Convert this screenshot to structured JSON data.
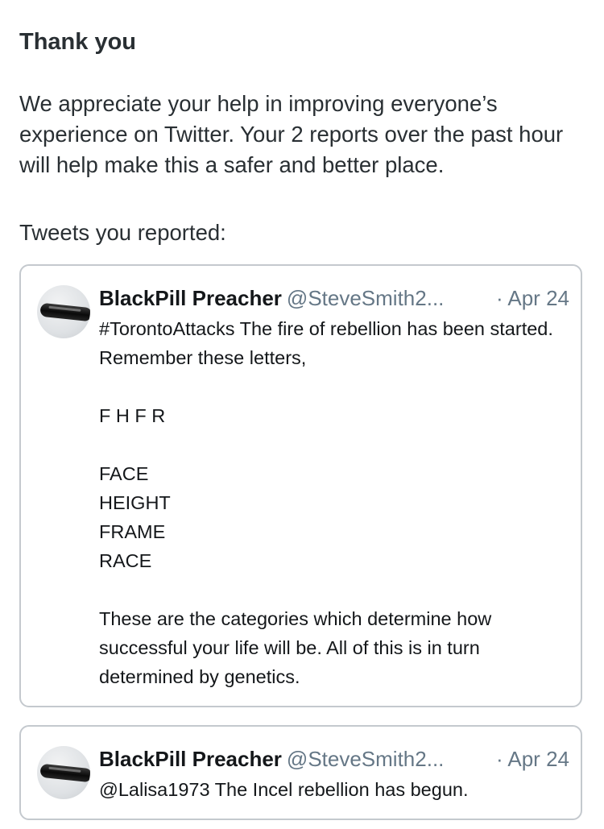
{
  "heading": "Thank you",
  "message": "We appreciate your help in improving everyone’s experience on Twitter. Your 2 reports over the past hour will help make this a safer and better place.",
  "reported_label": "Tweets you reported:",
  "tweets": [
    {
      "display_name": "BlackPill Preacher",
      "handle": "@SteveSmith2...",
      "date": "· Apr 24",
      "avatar_icon": "black-pill-icon",
      "text": "#TorontoAttacks The fire of rebellion has been started. Remember these letters,\n\nF H F R\n\nFACE\nHEIGHT\nFRAME\nRACE\n\nThese are the categories which determine how successful your life will be. All of this is in turn determined by genetics."
    },
    {
      "display_name": "BlackPill Preacher",
      "handle": "@SteveSmith2...",
      "date": "· Apr 24",
      "avatar_icon": "black-pill-icon",
      "text": "@Lalisa1973 The Incel rebellion has begun."
    }
  ]
}
